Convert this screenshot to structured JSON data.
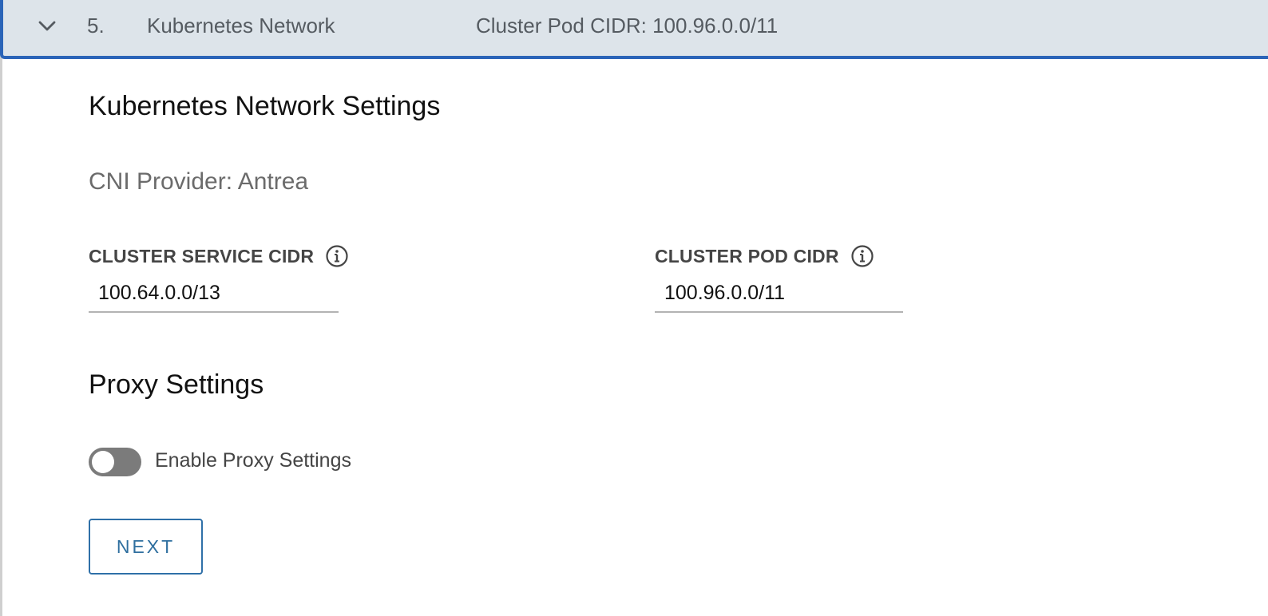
{
  "header": {
    "step_number": "5.",
    "step_title": "Kubernetes Network",
    "summary": "Cluster Pod CIDR: 100.96.0.0/11",
    "icon": "chevron-down-icon"
  },
  "network": {
    "title": "Kubernetes Network Settings",
    "cni_provider": "CNI Provider: Antrea",
    "service_cidr": {
      "label": "CLUSTER SERVICE CIDR",
      "value": "100.64.0.0/13",
      "icon": "info-icon"
    },
    "pod_cidr": {
      "label": "CLUSTER POD CIDR",
      "value": "100.96.0.0/11",
      "icon": "info-icon"
    }
  },
  "proxy": {
    "title": "Proxy Settings",
    "toggle_label": "Enable Proxy Settings",
    "enabled": false
  },
  "actions": {
    "next_label": "NEXT"
  },
  "colors": {
    "accent": "#2a64b8",
    "header_bg": "#dde4ea",
    "button_text": "#2f6f9f"
  }
}
